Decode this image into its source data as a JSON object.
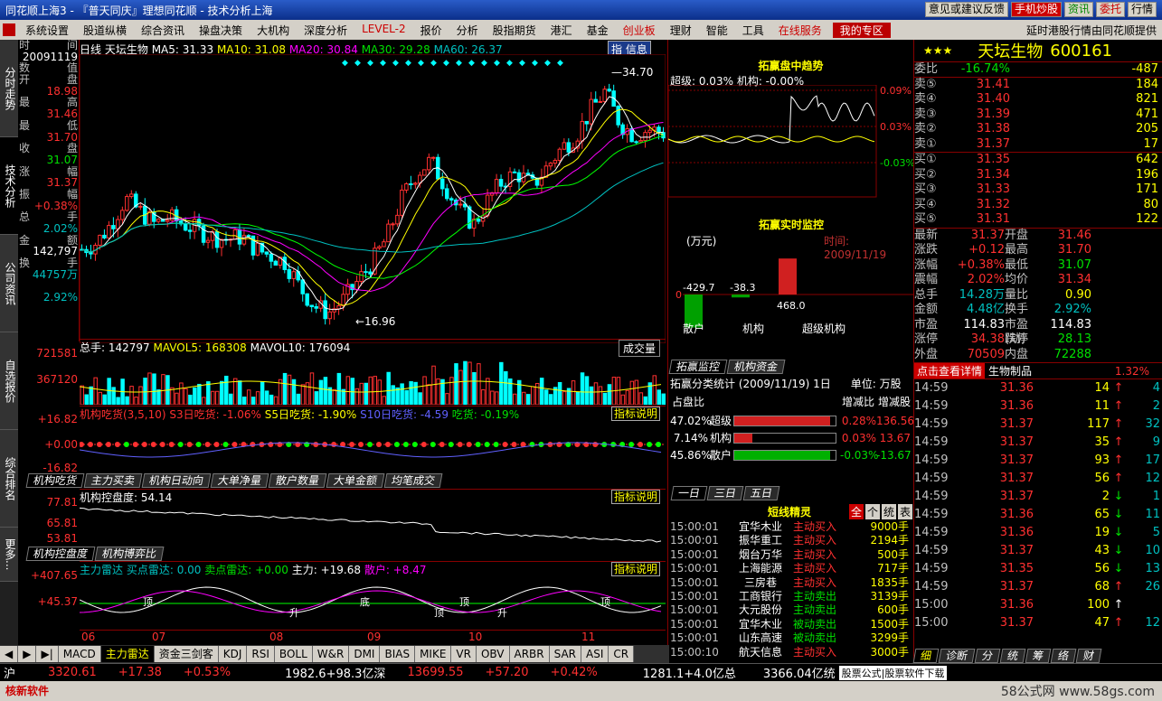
{
  "title": "同花顺上海3 - 『普天同庆』理想同花顺 - 技术分析上海",
  "title_btns": [
    "意见或建议反馈",
    "手机炒股",
    "资讯",
    "委托",
    "行情"
  ],
  "menu": [
    {
      "label": "系统设置",
      "cls": ""
    },
    {
      "label": "股道纵横",
      "cls": ""
    },
    {
      "label": "综合资讯",
      "cls": ""
    },
    {
      "label": "操盘决策",
      "cls": ""
    },
    {
      "label": "大机构",
      "cls": ""
    },
    {
      "label": "深度分析",
      "cls": ""
    },
    {
      "label": "LEVEL-2",
      "cls": "red"
    },
    {
      "label": "报价",
      "cls": ""
    },
    {
      "label": "分析",
      "cls": ""
    },
    {
      "label": "股指期货",
      "cls": ""
    },
    {
      "label": "港汇",
      "cls": ""
    },
    {
      "label": "基金",
      "cls": ""
    },
    {
      "label": "创业板",
      "cls": "red"
    },
    {
      "label": "理财",
      "cls": ""
    },
    {
      "label": "智能",
      "cls": ""
    },
    {
      "label": "工具",
      "cls": ""
    },
    {
      "label": "在线服务",
      "cls": "red"
    },
    {
      "label": "我的专区",
      "cls": "dark"
    }
  ],
  "menu_right": "延时港股行情由同花顺提供",
  "side_tabs": [
    "分时走势",
    "技术分析",
    "公司资讯",
    "自选报价",
    "综合排名",
    "更多..."
  ],
  "info": {
    "time_label": "时",
    "time_label2": "间",
    "date": "20091119",
    "num_label": "数",
    "num_label2": "值",
    "rows": [
      {
        "l": "开",
        "r": "盘",
        "v": "18.98",
        "c": "red"
      },
      {
        "l": "最",
        "r": "高",
        "v": "31.46",
        "c": "red"
      },
      {
        "l": "最",
        "r": "低",
        "v": "31.70",
        "c": "red"
      },
      {
        "l": "收",
        "r": "盘",
        "v": "31.07",
        "c": "grn"
      },
      {
        "l": "涨",
        "r": "幅",
        "v": "31.37",
        "c": "red"
      },
      {
        "l": "振",
        "r": "幅",
        "v": "+0.38%",
        "c": "red"
      },
      {
        "l": "总",
        "r": "手",
        "v": "2.02%",
        "c": "cyan"
      },
      {
        "l": "金",
        "r": "额",
        "v": "142,797",
        "c": "wht"
      },
      {
        "l": "换",
        "r": "手",
        "v": "44757万",
        "c": "cyan"
      },
      {
        "l": "",
        "r": "",
        "v": "2.92%",
        "c": "cyan"
      }
    ]
  },
  "chart_hdr": {
    "period": "日线",
    "name": "天坛生物",
    "ma5": "MA5: 31.33",
    "ma10": "MA10: 31.08",
    "ma20": "MA20: 30.84",
    "ma30": "MA30: 29.28",
    "ma60": "MA60: 26.37",
    "btn": "指 信息"
  },
  "chart_data": {
    "type": "candlestick",
    "high_label": "34.70",
    "low_label": "16.96",
    "x_ticks": [
      "06",
      "07",
      "08",
      "09",
      "10",
      "11"
    ]
  },
  "vol": {
    "text": "总手: 142797",
    "mavol5": "MAVOL5: 168308",
    "mavol10": "MAVOL10: 176094",
    "ticks": [
      "721581",
      "367120"
    ],
    "btn": "成交量"
  },
  "sub1": {
    "text": "机构吃货(3,5,10)",
    "s3": "S3日吃货: -1.06%",
    "s5": "S5日吃货: -1.90%",
    "s10": "S10日吃货: -4.59",
    "eat": "吃货: -0.19%",
    "ticks": [
      "+16.82",
      "+0.00",
      "-16.82"
    ],
    "btn": "指标说明"
  },
  "tabs1": [
    "机构吃货",
    "主力买卖",
    "机构日动向",
    "大单净量",
    "散户数量",
    "大单金额",
    "均笔成交"
  ],
  "sub2": {
    "text": "机构控盘度: 54.14",
    "ticks": [
      "77.81",
      "65.81",
      "53.81"
    ],
    "btn": "指标说明"
  },
  "tabs2": [
    "机构控盘度",
    "机构博弈比"
  ],
  "sub3": {
    "text": "主力雷达",
    "b": "买点雷达: 0.00",
    "s": "卖点雷达: +0.00",
    "z": "主力: +19.68",
    "r": "散户: +8.47",
    "ticks": [
      "+407.65",
      "+45.37"
    ],
    "btn": "指标说明",
    "marks": [
      "顶",
      "升",
      "底",
      "顶",
      "顶",
      "升",
      "顶"
    ]
  },
  "bottom_tabs": [
    "MACD",
    "主力雷达",
    "资金三剑客",
    "KDJ",
    "RSI",
    "BOLL",
    "W&R",
    "DMI",
    "BIAS",
    "MIKE",
    "VR",
    "OBV",
    "ARBR",
    "SAR",
    "ASI",
    "CR"
  ],
  "status": {
    "sh": "沪",
    "sh_v": "3320.61",
    "sh_c": "+17.38",
    "sh_p": "+0.53%",
    "sh_amt": "1982.6+98.3亿",
    "sz": "深",
    "sz_v": "13699.55",
    "sz_c": "+57.20",
    "sz_p": "+0.42%",
    "sz_amt": "1281.1+4.0亿",
    "tot": "总",
    "tot_v": "3366.04亿",
    "tot_r": "统",
    "ad": "股票公式|股票软件下载"
  },
  "bottom_left": "核新软件",
  "watermark": "58公式网 www.58gs.com",
  "mid": {
    "trend_title": "拓赢盘中趋势",
    "trend_labels": [
      "超级: 0.03%",
      "机构: -0.00%"
    ],
    "trend_ticks": [
      "0.09%",
      "0.03%",
      "-0.03%"
    ],
    "rt_title": "拓赢实时监控",
    "rt_unit": "(万元)",
    "rt_time": "时间: 2009/11/19",
    "rt_vals": [
      "-429.7",
      "-38.3",
      "468.0"
    ],
    "rt_x": [
      "散户",
      "机构",
      "超级机构"
    ],
    "rt_zero": "0",
    "tabs_a": [
      "拓赢监控",
      "机构资金"
    ],
    "stat_title": "拓赢分类统计 (2009/11/19) 1日",
    "stat_unit": "单位: 万股",
    "stat_hdr": [
      "占盘比",
      "增减比",
      "增减股"
    ],
    "stats": [
      {
        "p": "47.02%",
        "n": "超级",
        "r": "0.28%",
        "v": "136.56",
        "c": "red",
        "w": 0.95
      },
      {
        "p": "7.14%",
        "n": "机构",
        "r": "0.03%",
        "v": "13.67",
        "c": "red",
        "w": 0.18
      },
      {
        "p": "45.86%",
        "n": "散户",
        "r": "-0.03%",
        "v": "-13.67",
        "c": "grn",
        "w": 0.95
      }
    ],
    "tabs_b": [
      "一日",
      "三日",
      "五日"
    ],
    "elf_title": "短线精灵",
    "elf_btns": [
      "全",
      "个",
      "统",
      "表"
    ],
    "elf": [
      {
        "t": "15:00:01",
        "n": "宜华木业",
        "a": "主动买入",
        "v": "9000手"
      },
      {
        "t": "15:00:01",
        "n": "振华重工",
        "a": "主动买入",
        "v": "2194手"
      },
      {
        "t": "15:00:01",
        "n": "烟台万华",
        "a": "主动买入",
        "v": "500手"
      },
      {
        "t": "15:00:01",
        "n": "上海能源",
        "a": "主动买入",
        "v": "717手"
      },
      {
        "t": "15:00:01",
        "n": "三房巷",
        "a": "主动买入",
        "v": "1835手"
      },
      {
        "t": "15:00:01",
        "n": "工商银行",
        "a": "主动卖出",
        "v": "3139手"
      },
      {
        "t": "15:00:01",
        "n": "大元股份",
        "a": "主动卖出",
        "v": "600手"
      },
      {
        "t": "15:00:01",
        "n": "宜华木业",
        "a": "被动卖出",
        "v": "1500手"
      },
      {
        "t": "15:00:01",
        "n": "山东高速",
        "a": "被动卖出",
        "v": "3299手"
      },
      {
        "t": "15:00:10",
        "n": "航天信息",
        "a": "主动买入",
        "v": "3000手"
      }
    ]
  },
  "right": {
    "stars": "★★★",
    "name": "天坛生物",
    "code": "600161",
    "wb_label": "委比",
    "wb_v": "-16.74%",
    "wb_n": "-487",
    "asks": [
      {
        "l": "卖⑤",
        "p": "31.41",
        "v": "184"
      },
      {
        "l": "卖④",
        "p": "31.40",
        "v": "821"
      },
      {
        "l": "卖③",
        "p": "31.39",
        "v": "471"
      },
      {
        "l": "卖②",
        "p": "31.38",
        "v": "205"
      },
      {
        "l": "卖①",
        "p": "31.37",
        "v": "17"
      }
    ],
    "bids": [
      {
        "l": "买①",
        "p": "31.35",
        "v": "642"
      },
      {
        "l": "买②",
        "p": "31.34",
        "v": "196"
      },
      {
        "l": "买③",
        "p": "31.33",
        "v": "171"
      },
      {
        "l": "买④",
        "p": "31.32",
        "v": "80"
      },
      {
        "l": "买⑤",
        "p": "31.31",
        "v": "122"
      }
    ],
    "stats": [
      {
        "a": "最新",
        "b": "31.37",
        "bc": "red",
        "c": "开盘",
        "d": "31.46",
        "dc": "red"
      },
      {
        "a": "涨跌",
        "b": "+0.12",
        "bc": "red",
        "c": "最高",
        "d": "31.70",
        "dc": "red"
      },
      {
        "a": "涨幅",
        "b": "+0.38%",
        "bc": "red",
        "c": "最低",
        "d": "31.07",
        "dc": "grn"
      },
      {
        "a": "震幅",
        "b": "2.02%",
        "bc": "red",
        "c": "均价",
        "d": "31.34",
        "dc": "red"
      },
      {
        "a": "总手",
        "b": "14.28万",
        "bc": "cyan",
        "c": "量比",
        "d": "0.90",
        "dc": "yel"
      },
      {
        "a": "金额",
        "b": "4.48亿",
        "bc": "cyan",
        "c": "换手",
        "d": "2.92%",
        "dc": "cyan"
      },
      {
        "a": "市盈",
        "b": "114.83",
        "bc": "wht",
        "c": "市盈(动)",
        "d": "114.83",
        "dc": "wht"
      },
      {
        "a": "涨停",
        "b": "34.38",
        "bc": "red",
        "c": "跌停",
        "d": "28.13",
        "dc": "grn"
      },
      {
        "a": "外盘",
        "b": "70509",
        "bc": "red",
        "c": "内盘",
        "d": "72288",
        "dc": "grn"
      }
    ],
    "detail_btn": "点击查看详情",
    "sector": "生物制品",
    "sector_p": "1.32%",
    "ticks": [
      {
        "t": "14:59",
        "p": "31.36",
        "v": "14",
        "d": "↑",
        "n": "4",
        "pc": "red",
        "dc": "red"
      },
      {
        "t": "14:59",
        "p": "31.36",
        "v": "11",
        "d": "↑",
        "n": "2",
        "pc": "red",
        "dc": "red"
      },
      {
        "t": "14:59",
        "p": "31.37",
        "v": "117",
        "d": "↑",
        "n": "32",
        "pc": "red",
        "dc": "red"
      },
      {
        "t": "14:59",
        "p": "31.37",
        "v": "35",
        "d": "↑",
        "n": "9",
        "pc": "red",
        "dc": "red"
      },
      {
        "t": "14:59",
        "p": "31.37",
        "v": "93",
        "d": "↑",
        "n": "17",
        "pc": "red",
        "dc": "red"
      },
      {
        "t": "14:59",
        "p": "31.37",
        "v": "56",
        "d": "↑",
        "n": "12",
        "pc": "red",
        "dc": "red"
      },
      {
        "t": "14:59",
        "p": "31.37",
        "v": "2",
        "d": "↓",
        "n": "1",
        "pc": "red",
        "dc": "grn"
      },
      {
        "t": "14:59",
        "p": "31.36",
        "v": "65",
        "d": "↓",
        "n": "11",
        "pc": "red",
        "dc": "grn"
      },
      {
        "t": "14:59",
        "p": "31.36",
        "v": "19",
        "d": "↓",
        "n": "5",
        "pc": "red",
        "dc": "grn"
      },
      {
        "t": "14:59",
        "p": "31.37",
        "v": "43",
        "d": "↓",
        "n": "10",
        "pc": "red",
        "dc": "grn"
      },
      {
        "t": "14:59",
        "p": "31.35",
        "v": "56",
        "d": "↓",
        "n": "13",
        "pc": "red",
        "dc": "grn"
      },
      {
        "t": "14:59",
        "p": "31.37",
        "v": "68",
        "d": "↑",
        "n": "26",
        "pc": "red",
        "dc": "red"
      },
      {
        "t": "15:00",
        "p": "31.36",
        "v": "100",
        "d": "↑",
        "n": "",
        "pc": "red",
        "dc": "wht"
      },
      {
        "t": "15:00",
        "p": "31.37",
        "v": "47",
        "d": "↑",
        "n": "12",
        "pc": "red",
        "dc": "red"
      }
    ],
    "bot_tabs": [
      "细",
      "诊断",
      "分",
      "统",
      "筹",
      "络",
      "财"
    ]
  }
}
